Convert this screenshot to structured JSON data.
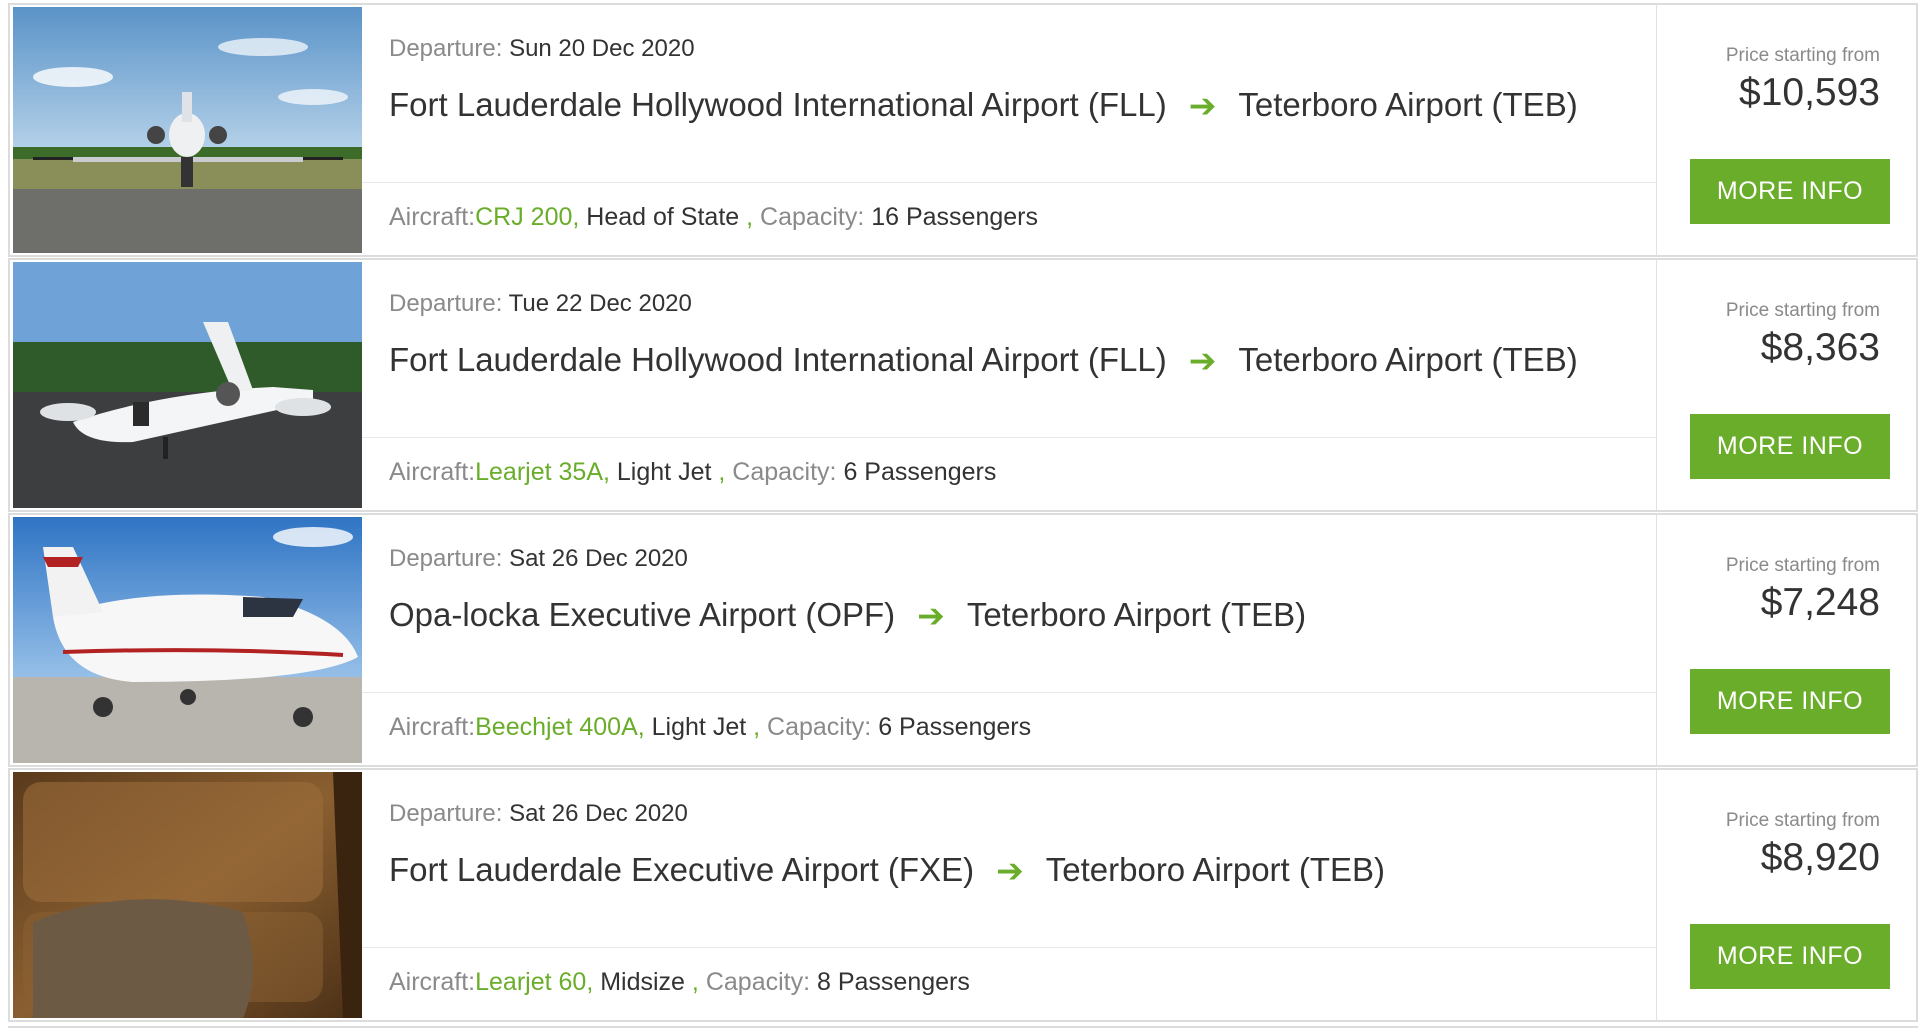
{
  "colors": {
    "accent": "#6aad2b",
    "muted": "#8a8a8a",
    "text": "#333333",
    "border": "#dcdcdc"
  },
  "flights": [
    {
      "departure_label": "Departure:",
      "departure_date": "Sun 20 Dec 2020",
      "origin": "Fort Lauderdale Hollywood International Airport (FLL)",
      "arrow_icon": "arrow-right-icon",
      "destination": "Teterboro Airport (TEB)",
      "aircraft_label": "Aircraft:",
      "aircraft_model": "CRJ 200,",
      "aircraft_class": "Head of State",
      "capacity_sep": ",",
      "capacity_label": "Capacity:",
      "capacity_value": "16 Passengers",
      "price_label": "Price starting from",
      "price": "$10,593",
      "button_label": "MORE INFO",
      "image": "jet-front-on-runway"
    },
    {
      "departure_label": "Departure:",
      "departure_date": "Tue 22 Dec 2020",
      "origin": "Fort Lauderdale Hollywood International Airport (FLL)",
      "arrow_icon": "arrow-right-icon",
      "destination": "Teterboro Airport (TEB)",
      "aircraft_label": "Aircraft:",
      "aircraft_model": "Learjet 35A,",
      "aircraft_class": "Light Jet",
      "capacity_sep": ",",
      "capacity_label": "Capacity:",
      "capacity_value": "6 Passengers",
      "price_label": "Price starting from",
      "price": "$8,363",
      "button_label": "MORE INFO",
      "image": "learjet-side-view"
    },
    {
      "departure_label": "Departure:",
      "departure_date": "Sat 26 Dec 2020",
      "origin": "Opa-locka Executive Airport (OPF)",
      "arrow_icon": "arrow-right-icon",
      "destination": "Teterboro Airport (TEB)",
      "aircraft_label": "Aircraft:",
      "aircraft_model": "Beechjet 400A,",
      "aircraft_class": "Light Jet",
      "capacity_sep": ",",
      "capacity_label": "Capacity:",
      "capacity_value": "6 Passengers",
      "price_label": "Price starting from",
      "price": "$7,248",
      "button_label": "MORE INFO",
      "image": "beechjet-on-tarmac"
    },
    {
      "departure_label": "Departure:",
      "departure_date": "Sat 26 Dec 2020",
      "origin": "Fort Lauderdale Executive Airport (FXE)",
      "arrow_icon": "arrow-right-icon",
      "destination": "Teterboro Airport (TEB)",
      "aircraft_label": "Aircraft:",
      "aircraft_model": "Learjet 60,",
      "aircraft_class": "Midsize",
      "capacity_sep": ",",
      "capacity_label": "Capacity:",
      "capacity_value": "8 Passengers",
      "price_label": "Price starting from",
      "price": "$8,920",
      "button_label": "MORE INFO",
      "image": "leather-cabin-seat"
    }
  ]
}
